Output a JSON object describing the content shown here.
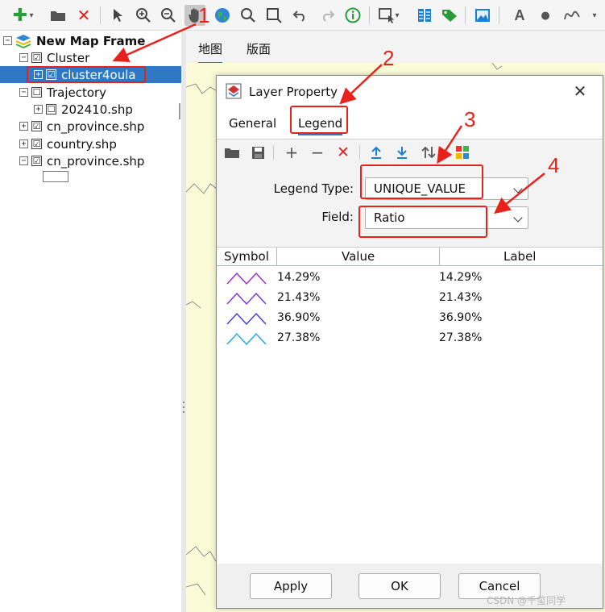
{
  "toolbar": {
    "icons": [
      "add-layer-icon",
      "dropdown-arrow-icon",
      "open-folder-icon",
      "remove-icon",
      "select-arrow-icon",
      "zoom-in-icon",
      "zoom-out-icon",
      "pan-hand-icon",
      "globe-icon",
      "search-icon",
      "select-rect-icon",
      "undo-icon",
      "redo-icon",
      "identify-icon",
      "select-feature-icon",
      "attribute-table-icon",
      "label-icon",
      "image-icon",
      "text-icon",
      "point-icon",
      "curve-icon"
    ]
  },
  "tree": {
    "frame_label": "New Map Frame",
    "items": [
      {
        "label": "Cluster",
        "checked": "☑"
      },
      {
        "label": "cluster4oula",
        "checked": "☑"
      },
      {
        "label": "Trajectory",
        "checked": "☐"
      },
      {
        "label": "202410.shp",
        "checked": "☐"
      },
      {
        "label": "cn_province.shp",
        "checked": "☑"
      },
      {
        "label": "country.shp",
        "checked": "☑"
      },
      {
        "label": "cn_province.shp",
        "checked": "☑"
      }
    ],
    "expand_collapsed": "+",
    "expand_open": "−"
  },
  "main_tabs": [
    "地图",
    "版面"
  ],
  "dialog": {
    "title": "Layer Property",
    "close": "✕",
    "tabs": [
      "General",
      "Legend"
    ],
    "legend_type_label": "Legend Type:",
    "legend_type_value": "UNIQUE_VALUE",
    "field_label": "Field:",
    "field_value": "Ratio",
    "columns": [
      "Symbol",
      "Value",
      "Label"
    ],
    "rows": [
      {
        "value": "14.29%",
        "label": "14.29%",
        "color": "#a020c8"
      },
      {
        "value": "21.43%",
        "label": "21.43%",
        "color": "#7a2be0"
      },
      {
        "value": "36.90%",
        "label": "36.90%",
        "color": "#3a3ad8"
      },
      {
        "value": "27.38%",
        "label": "27.38%",
        "color": "#1aa6e0"
      }
    ],
    "buttons": {
      "apply": "Apply",
      "ok": "OK",
      "cancel": "Cancel"
    }
  },
  "annotations": [
    "1",
    "2",
    "3",
    "4"
  ],
  "watermark": "CSDN @千玺同学",
  "colors": {
    "accent": "#2f78c4",
    "annotation": "#e8221b",
    "map_bg": "#fbfbd8"
  }
}
